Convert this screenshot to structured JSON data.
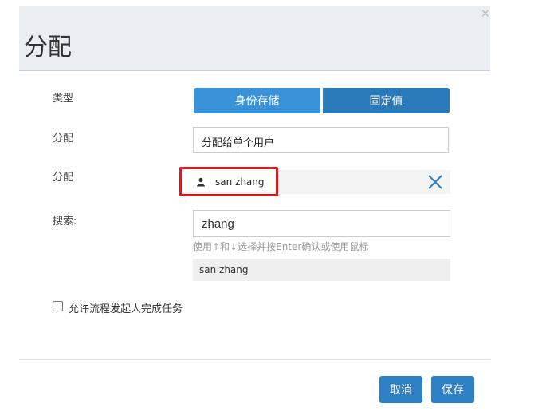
{
  "dialog": {
    "title": "分配",
    "close_glyph": "×"
  },
  "form": {
    "type_label": "类型",
    "type_options": [
      "身份存储",
      "固定值"
    ],
    "selected_type": "身份存储",
    "assign_mode_label": "分配",
    "assign_mode_value": "分配给单个用户",
    "assignee_label": "分配",
    "assignee_name": "san zhang",
    "search_label": "搜索:",
    "search_value": "zhang",
    "search_hint": "使用↑和↓选择并按Enter确认或使用鼠标",
    "search_results": [
      "san zhang"
    ],
    "allow_initiator_label": "允许流程发起人完成任务",
    "allow_initiator_checked": false
  },
  "footer": {
    "cancel_label": "取消",
    "save_label": "保存"
  },
  "colors": {
    "primary": "#2e7fc3",
    "highlight_border": "#e0141c",
    "header_bg": "#eaedf1"
  },
  "icons": {
    "assignee": "user-icon",
    "remove": "close-x-icon"
  }
}
